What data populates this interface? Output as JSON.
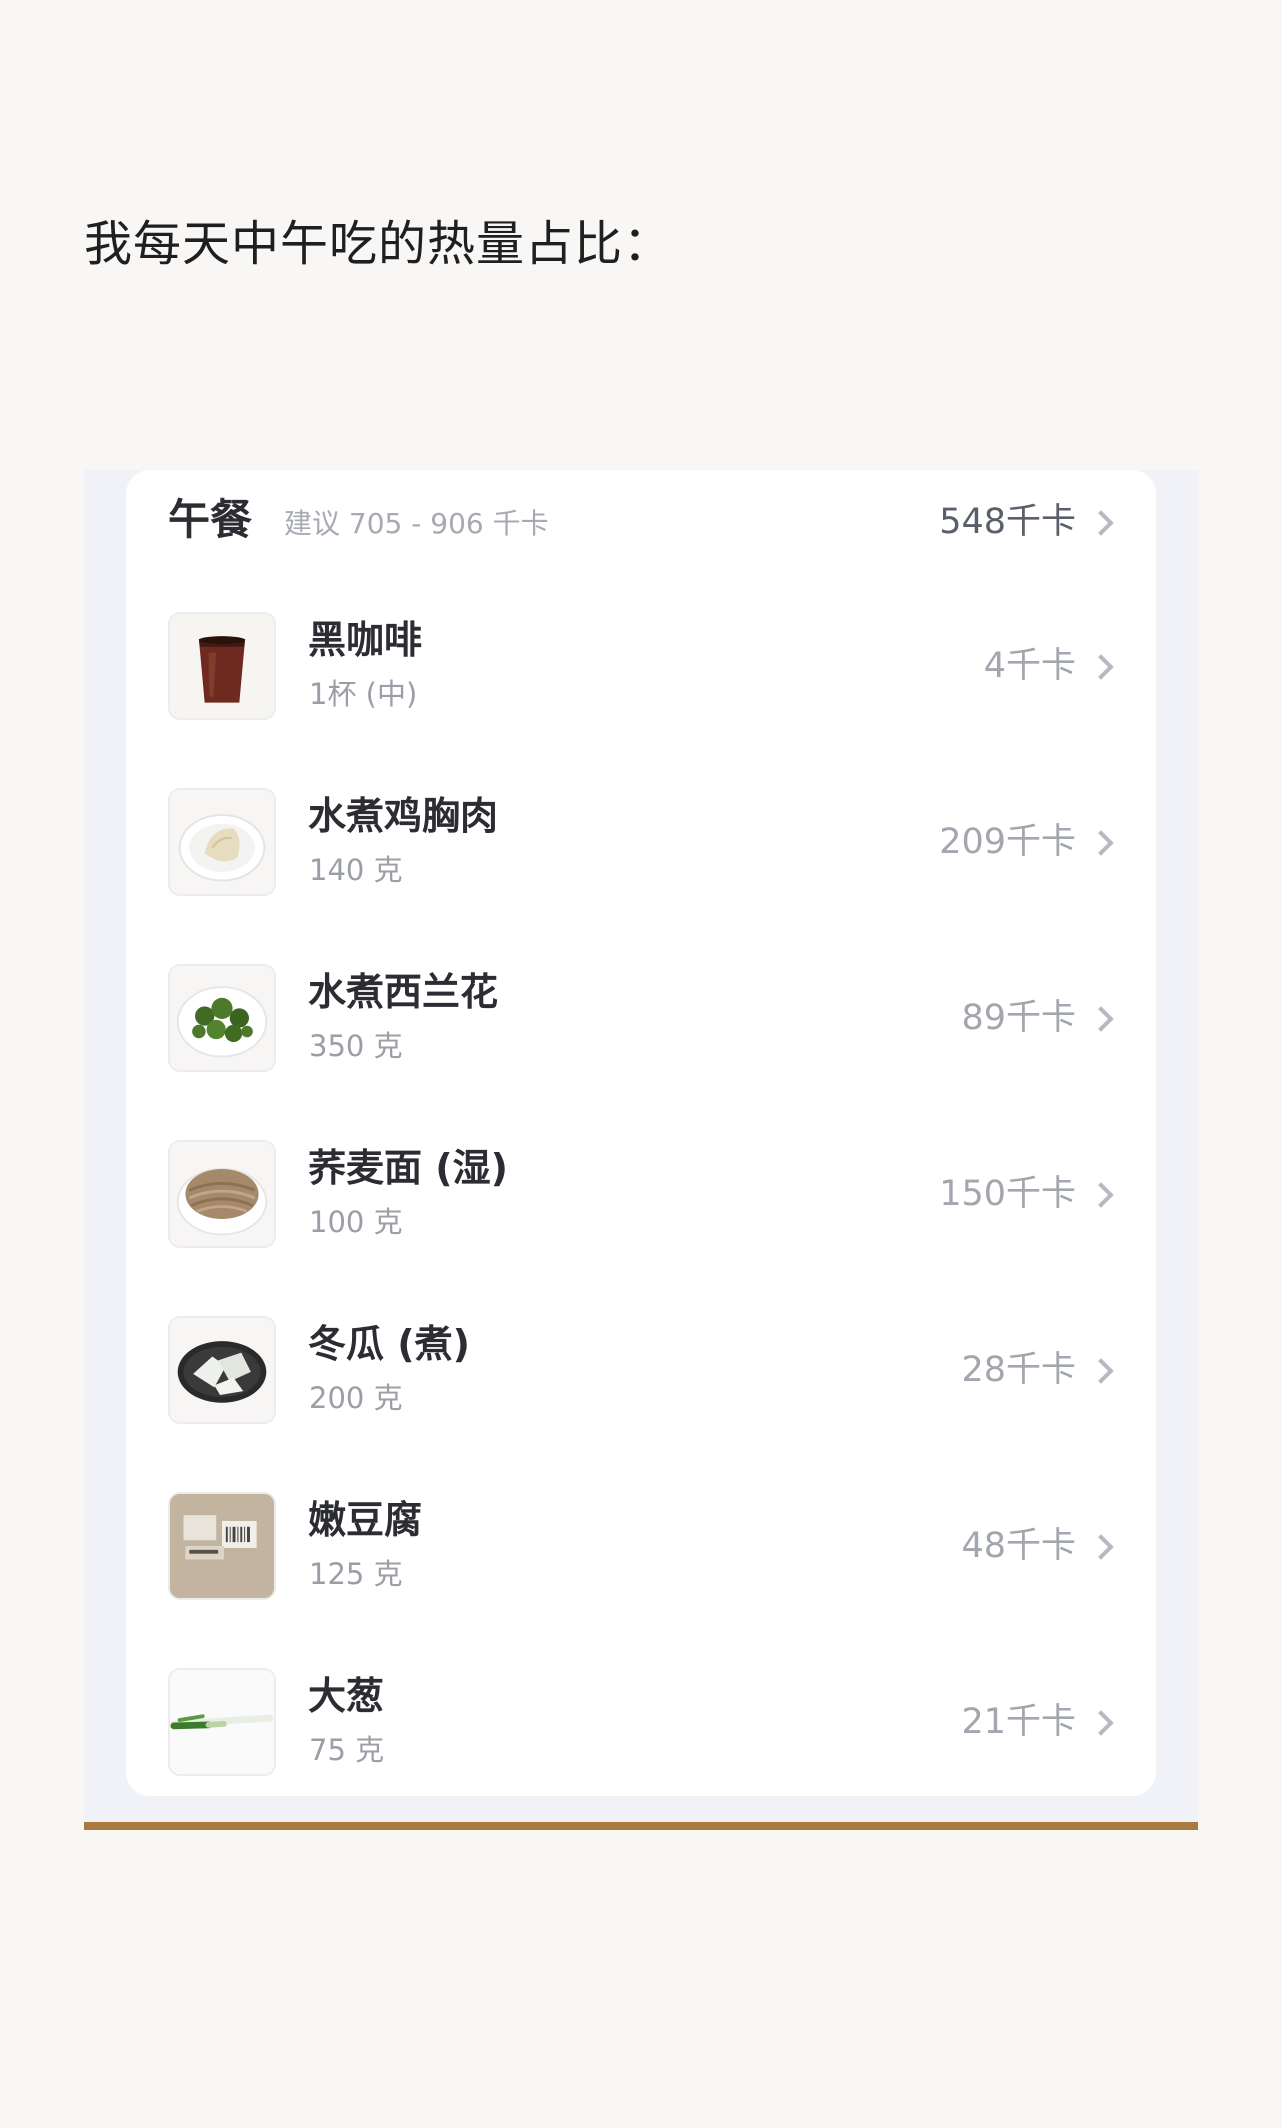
{
  "caption": "我每天中午吃的热量占比：",
  "meal": {
    "title": "午餐",
    "suggestion": "建议 705 - 906 千卡",
    "total": "548千卡"
  },
  "foods": [
    {
      "name": "黑咖啡",
      "amount": "1杯 (中)",
      "kcal": "4千卡",
      "icon": "black-coffee-photo"
    },
    {
      "name": "水煮鸡胸肉",
      "amount": "140 克",
      "kcal": "209千卡",
      "icon": "chicken-breast-photo"
    },
    {
      "name": "水煮西兰花",
      "amount": "350 克",
      "kcal": "89千卡",
      "icon": "broccoli-photo"
    },
    {
      "name": "荞麦面 (湿)",
      "amount": "100 克",
      "kcal": "150千卡",
      "icon": "soba-noodles-photo"
    },
    {
      "name": "冬瓜 (煮)",
      "amount": "200 克",
      "kcal": "28千卡",
      "icon": "winter-melon-photo"
    },
    {
      "name": "嫩豆腐",
      "amount": "125 克",
      "kcal": "48千卡",
      "icon": "tofu-package-photo"
    },
    {
      "name": "大葱",
      "amount": "75 克",
      "kcal": "21千卡",
      "icon": "scallion-photo"
    }
  ],
  "colors": {
    "accent_line": "#a87b3c",
    "card": "#ffffff",
    "page": "#f8f7f5"
  }
}
